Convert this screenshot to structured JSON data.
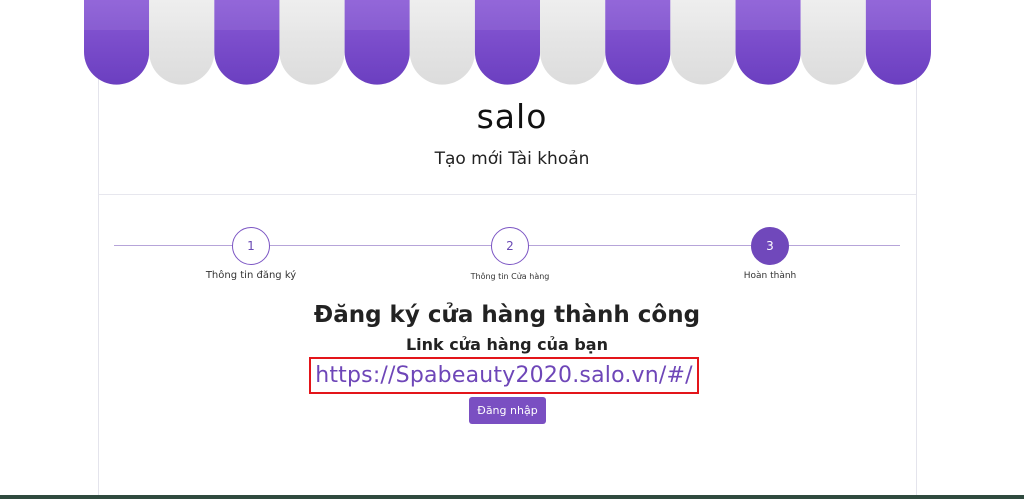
{
  "brand": {
    "logo_text": "salo"
  },
  "header": {
    "subtitle": "Tạo mới Tài khoản"
  },
  "steps": [
    {
      "number": "1",
      "label": "Thông tin đăng ký",
      "state": "done"
    },
    {
      "number": "2",
      "label": "Thông tin Cửa hàng",
      "state": "done"
    },
    {
      "number": "3",
      "label": "Hoàn thành",
      "state": "active"
    }
  ],
  "result": {
    "title": "Đăng ký cửa hàng thành công",
    "link_label": "Link cửa hàng của bạn",
    "store_url": "https://Spabeauty2020.salo.vn/#/",
    "login_button": "Đăng nhập"
  },
  "colors": {
    "accent": "#7048bb",
    "awning_purple": "#7b4fce",
    "awning_gray": "#e1e1e1",
    "highlight_border": "#e3151a"
  }
}
